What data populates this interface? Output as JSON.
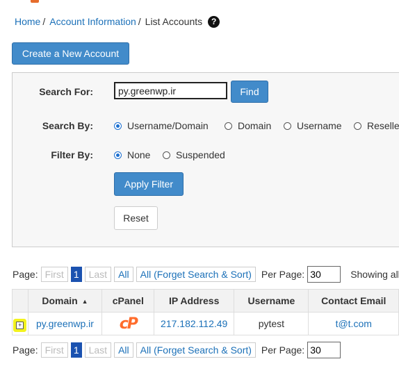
{
  "breadcrumb": {
    "home": "Home",
    "sep": "/",
    "section": "Account Information",
    "current": "List Accounts",
    "help_glyph": "?"
  },
  "actions": {
    "create_label": "Create a New Account"
  },
  "search": {
    "label": "Search For:",
    "value": "py.greenwp.ir",
    "find_label": "Find",
    "search_by_label": "Search By:",
    "search_by_options": [
      "Username/Domain",
      "Domain",
      "Username",
      "Reselle"
    ],
    "search_by_selected": "Username/Domain",
    "filter_by_label": "Filter By:",
    "filter_options": [
      "None",
      "Suspended"
    ],
    "filter_selected": "None",
    "apply_label": "Apply Filter",
    "reset_label": "Reset"
  },
  "pager": {
    "page_label": "Page:",
    "first": "First",
    "current": "1",
    "last": "Last",
    "all": "All",
    "all_forget": "All (Forget Search & Sort)",
    "per_page_label": "Per Page:",
    "per_page_value": "30",
    "showing": "Showing all"
  },
  "table": {
    "columns": [
      "Domain",
      "cPanel",
      "IP Address",
      "Username",
      "Contact Email"
    ],
    "sort_indicator": "▲",
    "rows": [
      {
        "domain": "py.greenwp.ir",
        "cpanel_logo": "cP",
        "ip": "217.182.112.49",
        "username": "pytest",
        "email": "t@t.com"
      }
    ]
  },
  "icons": {
    "expand": "plus-square-icon",
    "help": "question-circle-icon",
    "cpanel": "cpanel-logo"
  },
  "colors": {
    "primary": "#428bca",
    "link": "#1b70b8",
    "cpanel_orange": "#ff6c2c",
    "highlight": "#f2f21e"
  }
}
